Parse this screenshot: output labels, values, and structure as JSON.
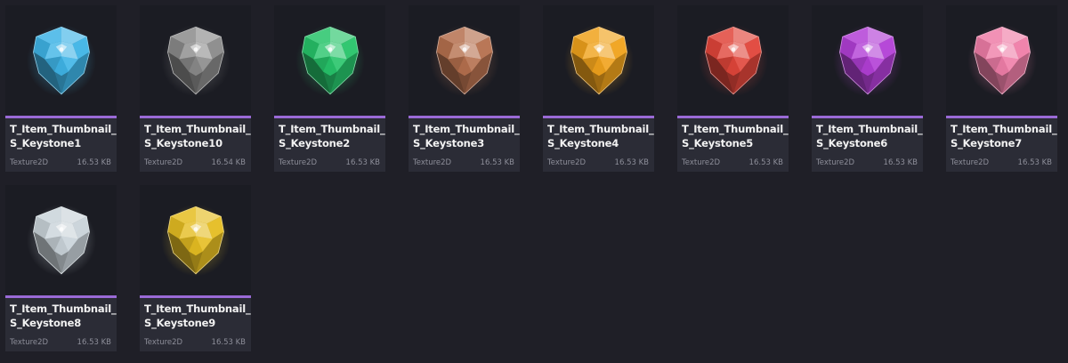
{
  "assets": [
    {
      "name": "T_Item_Thumbnail_\nS_Keystone1",
      "type": "Texture2D",
      "size": "16.53 KB",
      "gem_color": "#3fb4e6",
      "icon": "keystone-gem-cyan-icon"
    },
    {
      "name": "T_Item_Thumbnail_\nS_Keystone10",
      "type": "Texture2D",
      "size": "16.54 KB",
      "gem_color": "#8a8a8a",
      "icon": "keystone-gem-black-icon"
    },
    {
      "name": "T_Item_Thumbnail_\nS_Keystone2",
      "type": "Texture2D",
      "size": "16.53 KB",
      "gem_color": "#27c46a",
      "icon": "keystone-gem-green-icon"
    },
    {
      "name": "T_Item_Thumbnail_\nS_Keystone3",
      "type": "Texture2D",
      "size": "16.53 KB",
      "gem_color": "#b5704e",
      "icon": "keystone-gem-bronze-icon"
    },
    {
      "name": "T_Item_Thumbnail_\nS_Keystone4",
      "type": "Texture2D",
      "size": "16.53 KB",
      "gem_color": "#f0a21c",
      "icon": "keystone-gem-orange-icon"
    },
    {
      "name": "T_Item_Thumbnail_\nS_Keystone5",
      "type": "Texture2D",
      "size": "16.53 KB",
      "gem_color": "#e0453a",
      "icon": "keystone-gem-red-icon"
    },
    {
      "name": "T_Item_Thumbnail_\nS_Keystone6",
      "type": "Texture2D",
      "size": "16.53 KB",
      "gem_color": "#b23fd6",
      "icon": "keystone-gem-purple-icon"
    },
    {
      "name": "T_Item_Thumbnail_\nS_Keystone7",
      "type": "Texture2D",
      "size": "16.53 KB",
      "gem_color": "#ef7ea8",
      "icon": "keystone-gem-pink-icon"
    },
    {
      "name": "T_Item_Thumbnail_\nS_Keystone8",
      "type": "Texture2D",
      "size": "16.53 KB",
      "gem_color": "#c9d3d9",
      "icon": "keystone-gem-white-icon"
    },
    {
      "name": "T_Item_Thumbnail_\nS_Keystone9",
      "type": "Texture2D",
      "size": "16.53 KB",
      "gem_color": "#e5bd22",
      "icon": "keystone-gem-gold-icon"
    }
  ],
  "colors": {
    "type_bar": "#9a6ad6",
    "background": "#1f1f27",
    "tile": "#2b2c36"
  }
}
